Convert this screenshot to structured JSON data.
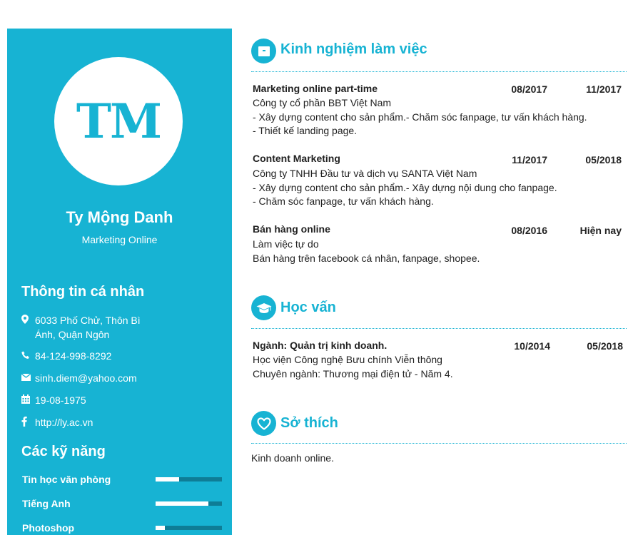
{
  "profile": {
    "initials": "TM",
    "name": "Ty Mộng Danh",
    "role": "Marketing Online"
  },
  "personal": {
    "heading": "Thông tin cá nhân",
    "address": "6033 Phố Chử, Thôn Bì Ánh, Quận Ngôn",
    "phone": "84-124-998-8292",
    "email": "sinh.diem@yahoo.com",
    "birthday": "19-08-1975",
    "website": "http://ly.ac.vn"
  },
  "skills": {
    "heading": "Các kỹ năng",
    "items": [
      {
        "label": "Tin học văn phòng",
        "level": 0.35
      },
      {
        "label": "Tiếng Anh",
        "level": 0.8
      },
      {
        "label": "Photoshop",
        "level": 0.14
      }
    ]
  },
  "experience": {
    "heading": "Kinh nghiệm làm việc",
    "jobs": [
      {
        "title": "Marketing online part-time",
        "start": "08/2017",
        "end": "11/2017",
        "company": "Công ty cổ phần BBT Việt Nam",
        "line1": "- Xây dựng content cho sản phẩm.- Chăm sóc fanpage, tư vấn khách hàng.",
        "line2": "- Thiết kế landing page."
      },
      {
        "title": "Content Marketing",
        "start": "11/2017",
        "end": "05/2018",
        "company": "Công ty TNHH Đầu tư và dịch vụ SANTA Việt Nam",
        "line1": "- Xây dựng content cho sản phẩm.- Xây dựng nội dung cho fanpage.",
        "line2": "- Chăm sóc fanpage, tư vấn khách hàng."
      },
      {
        "title": "Bán hàng online",
        "start": "08/2016",
        "end": "Hiện nay",
        "company": "Làm việc tự do",
        "line1": "Bán hàng trên facebook cá nhân, fanpage, shopee."
      }
    ]
  },
  "education": {
    "heading": "Học vấn",
    "title": "Ngành: Quản trị kinh doanh.",
    "start": "10/2014",
    "end": "05/2018",
    "school": "Học viện Công nghệ Bưu chính Viễn thông",
    "detail": "Chuyên ngành: Thương mại điện tử - Năm 4."
  },
  "hobbies": {
    "heading": "Sở thích",
    "text": "Kinh doanh online."
  },
  "colors": {
    "accent": "#17b3d3",
    "bar_track": "#0e7d96"
  },
  "icons": {
    "address": "map-pin-icon",
    "phone": "phone-icon",
    "email": "envelope-icon",
    "birthday": "calendar-icon",
    "website": "facebook-icon",
    "experience": "briefcase-icon",
    "education": "graduation-cap-icon",
    "hobbies": "heart-icon"
  }
}
